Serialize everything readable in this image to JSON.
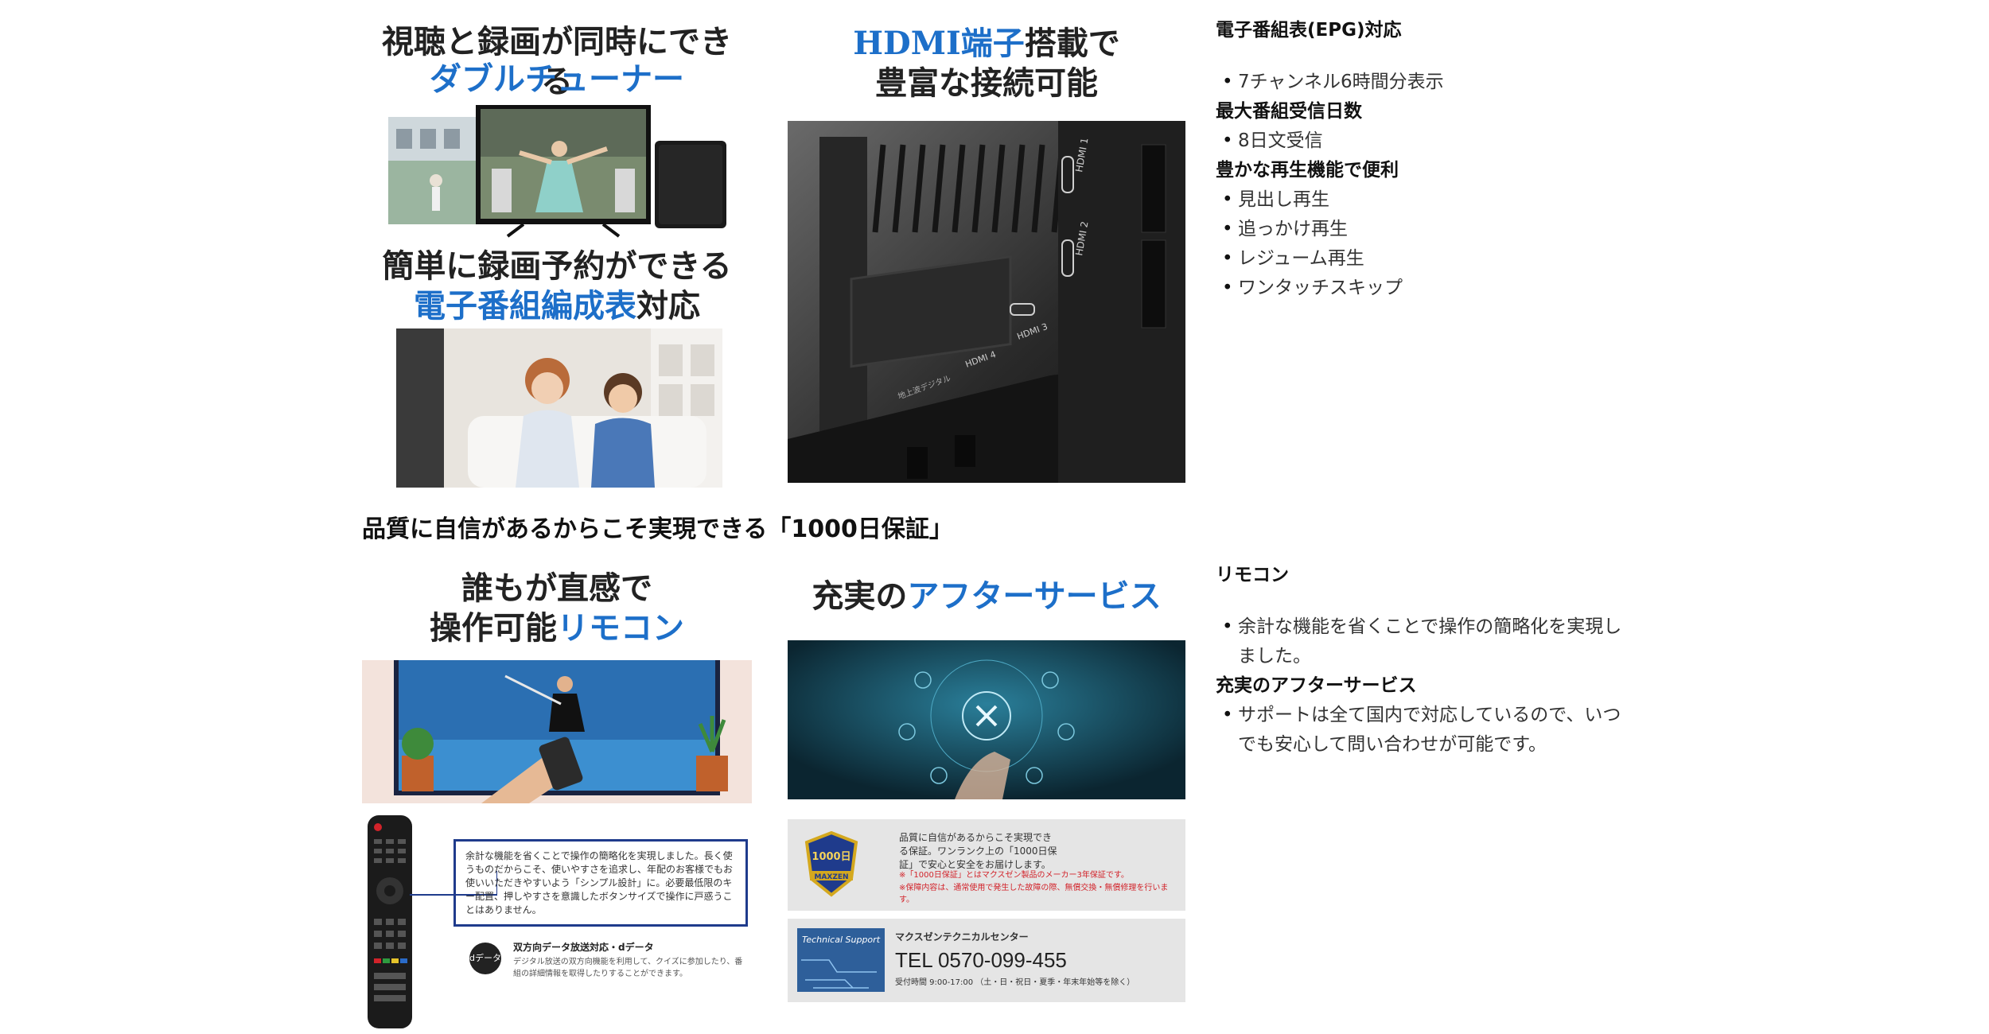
{
  "panels": {
    "tuner": {
      "line1": "視聴と録画が同時にできる",
      "line2": "ダブルチューナー"
    },
    "hdmi": {
      "line1_blue": "HDMI端子",
      "line1_dark": "搭載で",
      "line2": "豊富な接続可能",
      "ports": [
        "HDMI 1",
        "HDMI 2",
        "HDMI 4",
        "HDMI 3"
      ],
      "small_label": "地上波デジタル"
    },
    "epg": {
      "line1": "簡単に録画予約ができる",
      "line2_blue": "電子番組編成表",
      "line2_dark": "対応"
    },
    "remote": {
      "line1": "誰もが直感で",
      "line2_dark": "操作可能",
      "line2_blue": "リモコン",
      "box_text": "余計な機能を省くことで操作の簡略化を実現しました。長く使うものだからこそ、使いやすさを追求し、年配のお客様でもお使いいただきやすいよう「シンプル設計」に。必要最低限のキー配置、押しやすさを意識したボタンサイズで操作に戸惑うことはありません。",
      "data_title": "双方向データ放送対応・dデータ",
      "data_desc": "デジタル放送の双方向機能を利用して、クイズに参加したり、番組の詳細情報を取得したりすることができます。",
      "d_badge": "dデータ"
    },
    "service": {
      "line1_dark": "充実の",
      "line1_blue": "アフターサービス",
      "guarantee_text": "品質に自信があるからこそ実現できる保証。ワンランク上の「1000日保証」で安心と安全をお届けします。",
      "guarantee_note1": "※「1000日保証」とはマクスゼン製品のメーカー3年保証です。",
      "guarantee_note2": "※保障内容は、通常使用で発生した故障の際、無償交換・無償修理を行います。",
      "badge_days": "1000日",
      "badge_brand": "MAXZEN",
      "support_label": "Technical Support",
      "center_name": "マクスゼンテクニカルセンター",
      "tel": "TEL 0570-099-455",
      "hours": "受付時間 9:00-17:00 （土・日・祝日・夏季・年末年始等を除く）"
    }
  },
  "mid_title": "品質に自信があるからこそ実現できる「1000日保証」",
  "specs_top": [
    {
      "heading": "電子番組表(EPG)対応",
      "items": [
        "7チャンネル6時間分表示"
      ]
    },
    {
      "heading": "最大番組受信日数",
      "items": [
        "8日文受信"
      ]
    },
    {
      "heading": "豊かな再生機能で便利",
      "items": [
        "見出し再生",
        "追っかけ再生",
        "レジューム再生",
        "ワンタッチスキップ"
      ]
    }
  ],
  "specs_bottom": [
    {
      "heading": "リモコン",
      "items": [
        "余計な機能を省くことで操作の簡略化を実現しました。"
      ]
    },
    {
      "heading": "充実のアフターサービス",
      "items": [
        "サポートは全て国内で対応しているので、いつでも安心して問い合わせが可能です。"
      ]
    }
  ],
  "colors": {
    "accent_blue": "#1d6fc9",
    "dark_panel": "#1c1c1c",
    "service_teal": "#0f3a4a",
    "warning_red": "#d2232a"
  }
}
